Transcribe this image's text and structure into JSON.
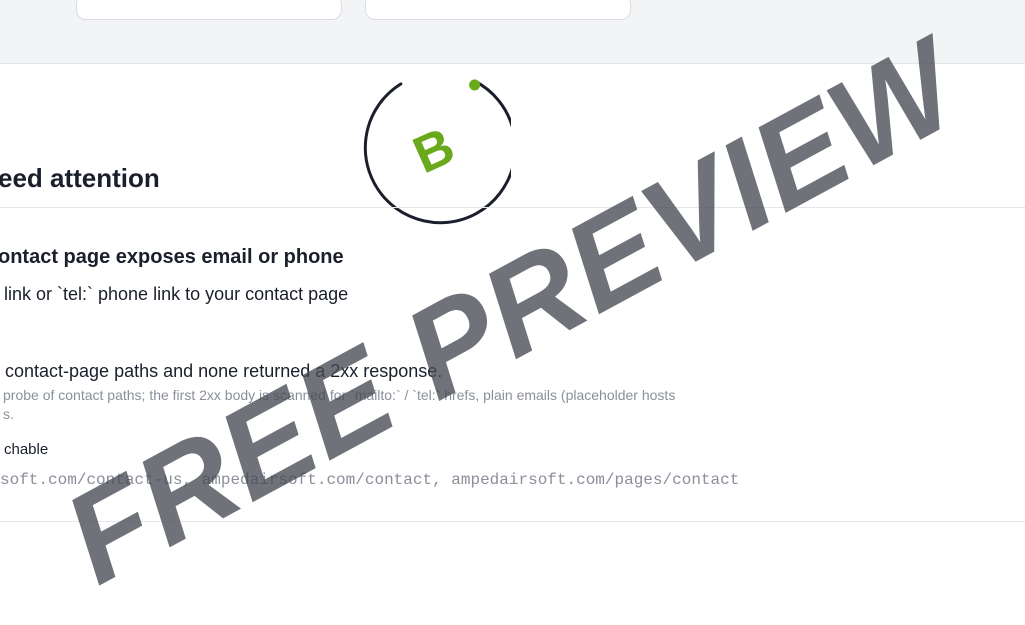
{
  "badge": {
    "grade": "B",
    "ring_color": "#1a1f2b",
    "accent_color": "#6aa91c"
  },
  "section": {
    "title": "eed attention"
  },
  "issue": {
    "title": "ontact page exposes email or phone",
    "description": "link or `tel:` phone link to your contact page",
    "finding": "contact-page paths and none returned a 2xx response.",
    "method_line1": "probe of contact paths; the first 2xx body is scanned for `mailto:` / `tel:` hrefs, plain emails (placeholder hosts",
    "method_line2": "s.",
    "status": "chable",
    "paths": "soft.com/contact-us, ampedairsoft.com/contact, ampedairsoft.com/pages/contact"
  },
  "watermark": {
    "text": "FREE PREVIEW"
  }
}
